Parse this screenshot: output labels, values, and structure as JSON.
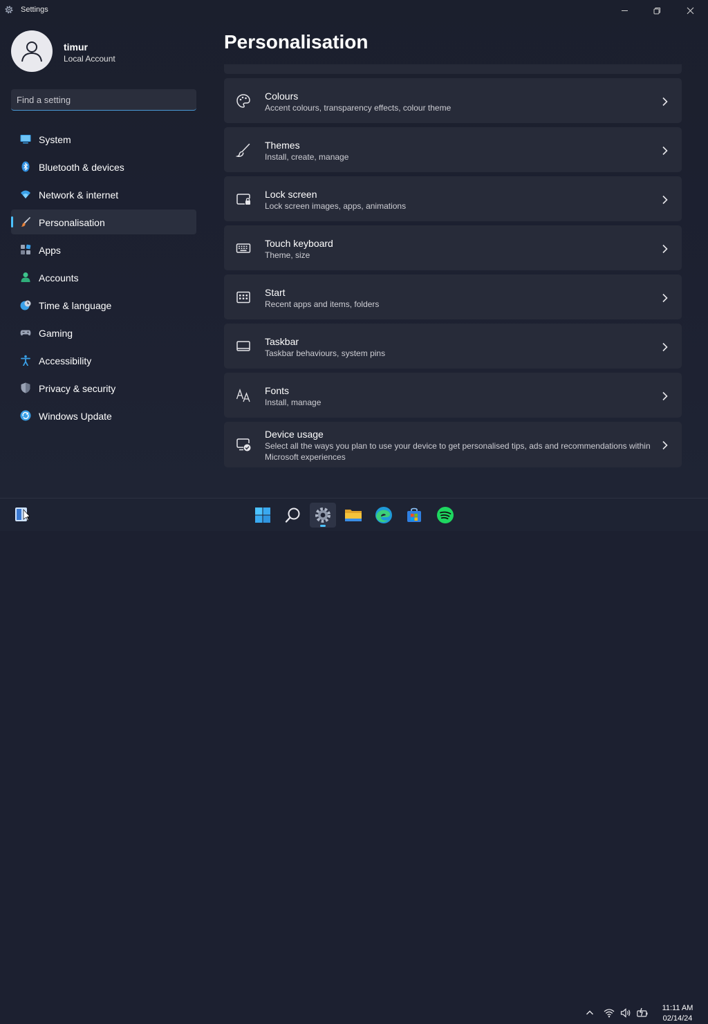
{
  "window": {
    "title": "Settings"
  },
  "profile": {
    "name": "timur",
    "account_type": "Local Account"
  },
  "search": {
    "placeholder": "Find a setting"
  },
  "sidebar": {
    "items": [
      {
        "label": "System",
        "icon": "monitor-icon"
      },
      {
        "label": "Bluetooth & devices",
        "icon": "bluetooth-icon"
      },
      {
        "label": "Network & internet",
        "icon": "wifi-icon"
      },
      {
        "label": "Personalisation",
        "icon": "brush-icon",
        "selected": true
      },
      {
        "label": "Apps",
        "icon": "apps-icon"
      },
      {
        "label": "Accounts",
        "icon": "person-icon"
      },
      {
        "label": "Time & language",
        "icon": "clock-globe-icon"
      },
      {
        "label": "Gaming",
        "icon": "gamepad-icon"
      },
      {
        "label": "Accessibility",
        "icon": "accessibility-icon"
      },
      {
        "label": "Privacy & security",
        "icon": "shield-icon"
      },
      {
        "label": "Windows Update",
        "icon": "update-icon"
      }
    ]
  },
  "main": {
    "title": "Personalisation",
    "cards": [
      {
        "title": "Colours",
        "description": "Accent colours, transparency effects, colour theme",
        "icon": "palette-icon"
      },
      {
        "title": "Themes",
        "description": "Install, create, manage",
        "icon": "brush-icon"
      },
      {
        "title": "Lock screen",
        "description": "Lock screen images, apps, animations",
        "icon": "lock-screen-icon"
      },
      {
        "title": "Touch keyboard",
        "description": "Theme, size",
        "icon": "keyboard-icon"
      },
      {
        "title": "Start",
        "description": "Recent apps and items, folders",
        "icon": "start-icon"
      },
      {
        "title": "Taskbar",
        "description": "Taskbar behaviours, system pins",
        "icon": "taskbar-icon"
      },
      {
        "title": "Fonts",
        "description": "Install, manage",
        "icon": "fonts-icon"
      },
      {
        "title": "Device usage",
        "description": "Select all the ways you plan to use your device to get personalised tips, ads and recommendations within Microsoft experiences",
        "icon": "device-usage-icon"
      }
    ]
  },
  "taskbar": {
    "apps": [
      "windows-start-icon",
      "search-icon",
      "settings-icon",
      "file-explorer-icon",
      "edge-icon",
      "store-icon",
      "spotify-icon"
    ],
    "active_app": "settings-icon",
    "time": "11:11 AM",
    "date": "02/14/24"
  },
  "colors": {
    "accent": "#4cc2ff",
    "background": "#1c2030",
    "card": "#272b39"
  }
}
